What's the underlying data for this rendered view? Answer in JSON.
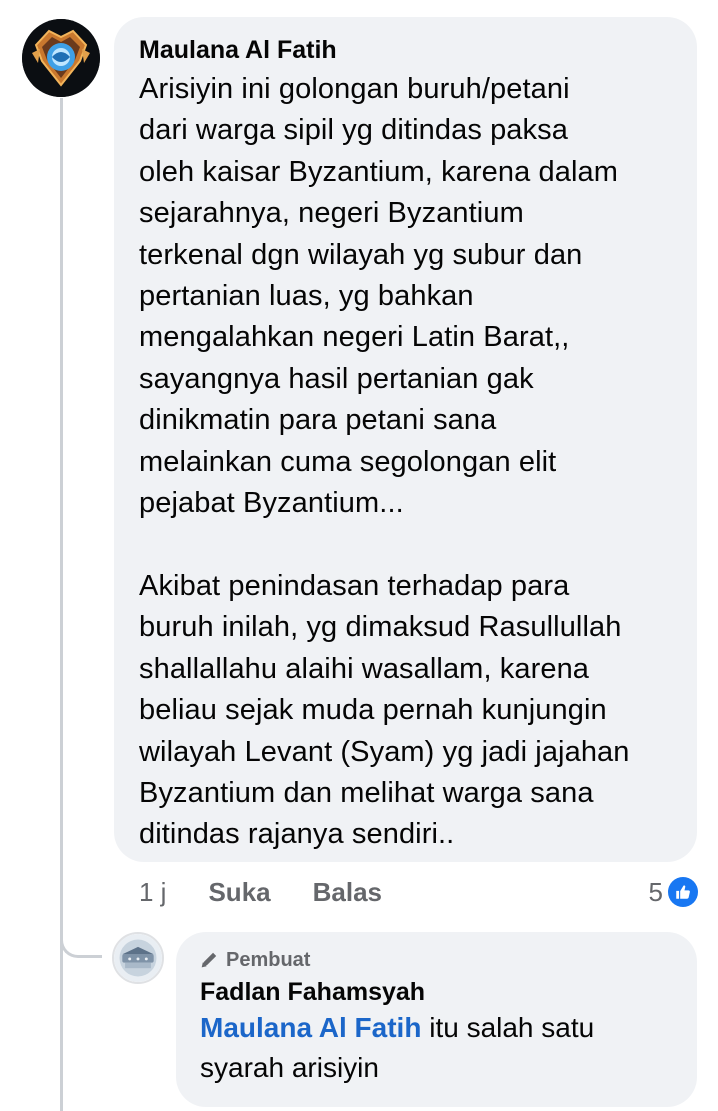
{
  "main_comment": {
    "author": "Maulana Al Fatih",
    "text": "Arisiyin ini golongan buruh/petani\ndari warga sipil yg ditindas paksa\noleh kaisar Byzantium, karena dalam\nsejarahnya, negeri Byzantium\nterkenal dgn wilayah yg subur dan\npertanian luas, yg bahkan\nmengalahkan negeri Latin Barat,,\nsayangnya hasil pertanian gak\ndinikmatin para petani sana\nmelainkan cuma segolongan elit\npejabat Byzantium...\n\nAkibat penindasan terhadap para\nburuh inilah, yg dimaksud Rasullullah\nshallallahu alaihi wasallam, karena\nbeliau sejak muda pernah kunjungin\nwilayah Levant (Syam) yg jadi jajahan\nByzantium dan melihat warga sana\nditindas rajanya sendiri..",
    "time": "1 j",
    "like_label": "Suka",
    "reply_label": "Balas",
    "reaction_count": "5",
    "reaction_icon": "like-icon"
  },
  "reply": {
    "badge_label": "Pembuat",
    "badge_icon": "pencil-icon",
    "author": "Fadlan Fahamsyah",
    "mention": "Maulana Al Fatih",
    "text": " itu salah satu syarah arisiyin"
  },
  "colors": {
    "bubble": "#f0f2f5",
    "mention": "#1b66c9",
    "like": "#1877f2",
    "meta": "#65676b",
    "thread_line": "#ccd0d5"
  }
}
